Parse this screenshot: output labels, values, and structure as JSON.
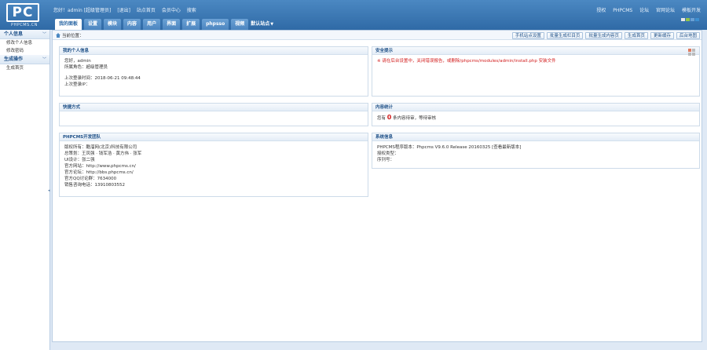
{
  "logo": {
    "mark": "PC",
    "sub": "PHPCMS.CN"
  },
  "header": {
    "info": [
      "您好！admin [超级管理员]",
      "[退出]",
      "站点首页",
      "会员中心",
      "搜索"
    ],
    "right_links": [
      "授权",
      "PHPCMS",
      "论坛",
      "官网论坛",
      "模板开发"
    ]
  },
  "nav": {
    "tabs": [
      "我的面板",
      "设置",
      "模块",
      "内容",
      "用户",
      "界面",
      "扩展",
      "phpsso",
      "视频"
    ],
    "active": 0,
    "dropdown": "默认站点"
  },
  "sidebar": {
    "sections": [
      {
        "title": "个人信息",
        "items": [
          "修改个人信息",
          "修改密码"
        ]
      },
      {
        "title": "生成操作",
        "items": [
          "生成首页"
        ]
      }
    ]
  },
  "breadcrumb": {
    "label": "当前位置："
  },
  "quick_links": [
    "手机站点设置",
    "批量生成栏目页",
    "批量生成内容页",
    "生成首页",
    "更新缓存",
    "后台地图"
  ],
  "panels": {
    "my_info": {
      "title": "我的个人信息",
      "lines": [
        "您好，admin",
        "所属角色：超级管理员"
      ],
      "lines2": [
        "上次登录时间：2018-06-21 09:48:44",
        "上次登录IP："
      ]
    },
    "security": {
      "title": "安全提示",
      "warning": "※ 请在后台设置中，关闭错误报告，或删除/phpcms/modules/admin/install.php 安装文件"
    },
    "shortcuts": {
      "title": "快捷方式"
    },
    "content_review": {
      "title": "内容统计",
      "prefix": "您有",
      "count": "0",
      "suffix": "条内容待审，等待审核"
    },
    "team": {
      "title": "PHPCMS开发团队",
      "lines": [
        "版权所有：酷溜网(北京)科技有限公司",
        "总策划：王凤强 · 钱军浩 · 黄方伟 · 张军",
        "UI设计：张二强",
        "官方网站：http://www.phpcms.cn/",
        "官方论坛：http://bbs.phpcms.cn/",
        "官方QQ讨论群：7634000",
        "销售咨询电话：13910803552"
      ]
    },
    "sysinfo": {
      "title": "系统信息",
      "lines": [
        "PHPCMS程序版本：Phpcms V9.6.0 Release 20160325 [查看最新版本]",
        "授权类型：",
        "序列号："
      ]
    }
  },
  "colors": {
    "header": "#3a78b6",
    "accent": "#1d4f87",
    "warning": "#d21b1b",
    "skins": [
      "#e6e6e6",
      "#8fc34a",
      "#6aa0d4",
      "#3d8fd1"
    ]
  }
}
